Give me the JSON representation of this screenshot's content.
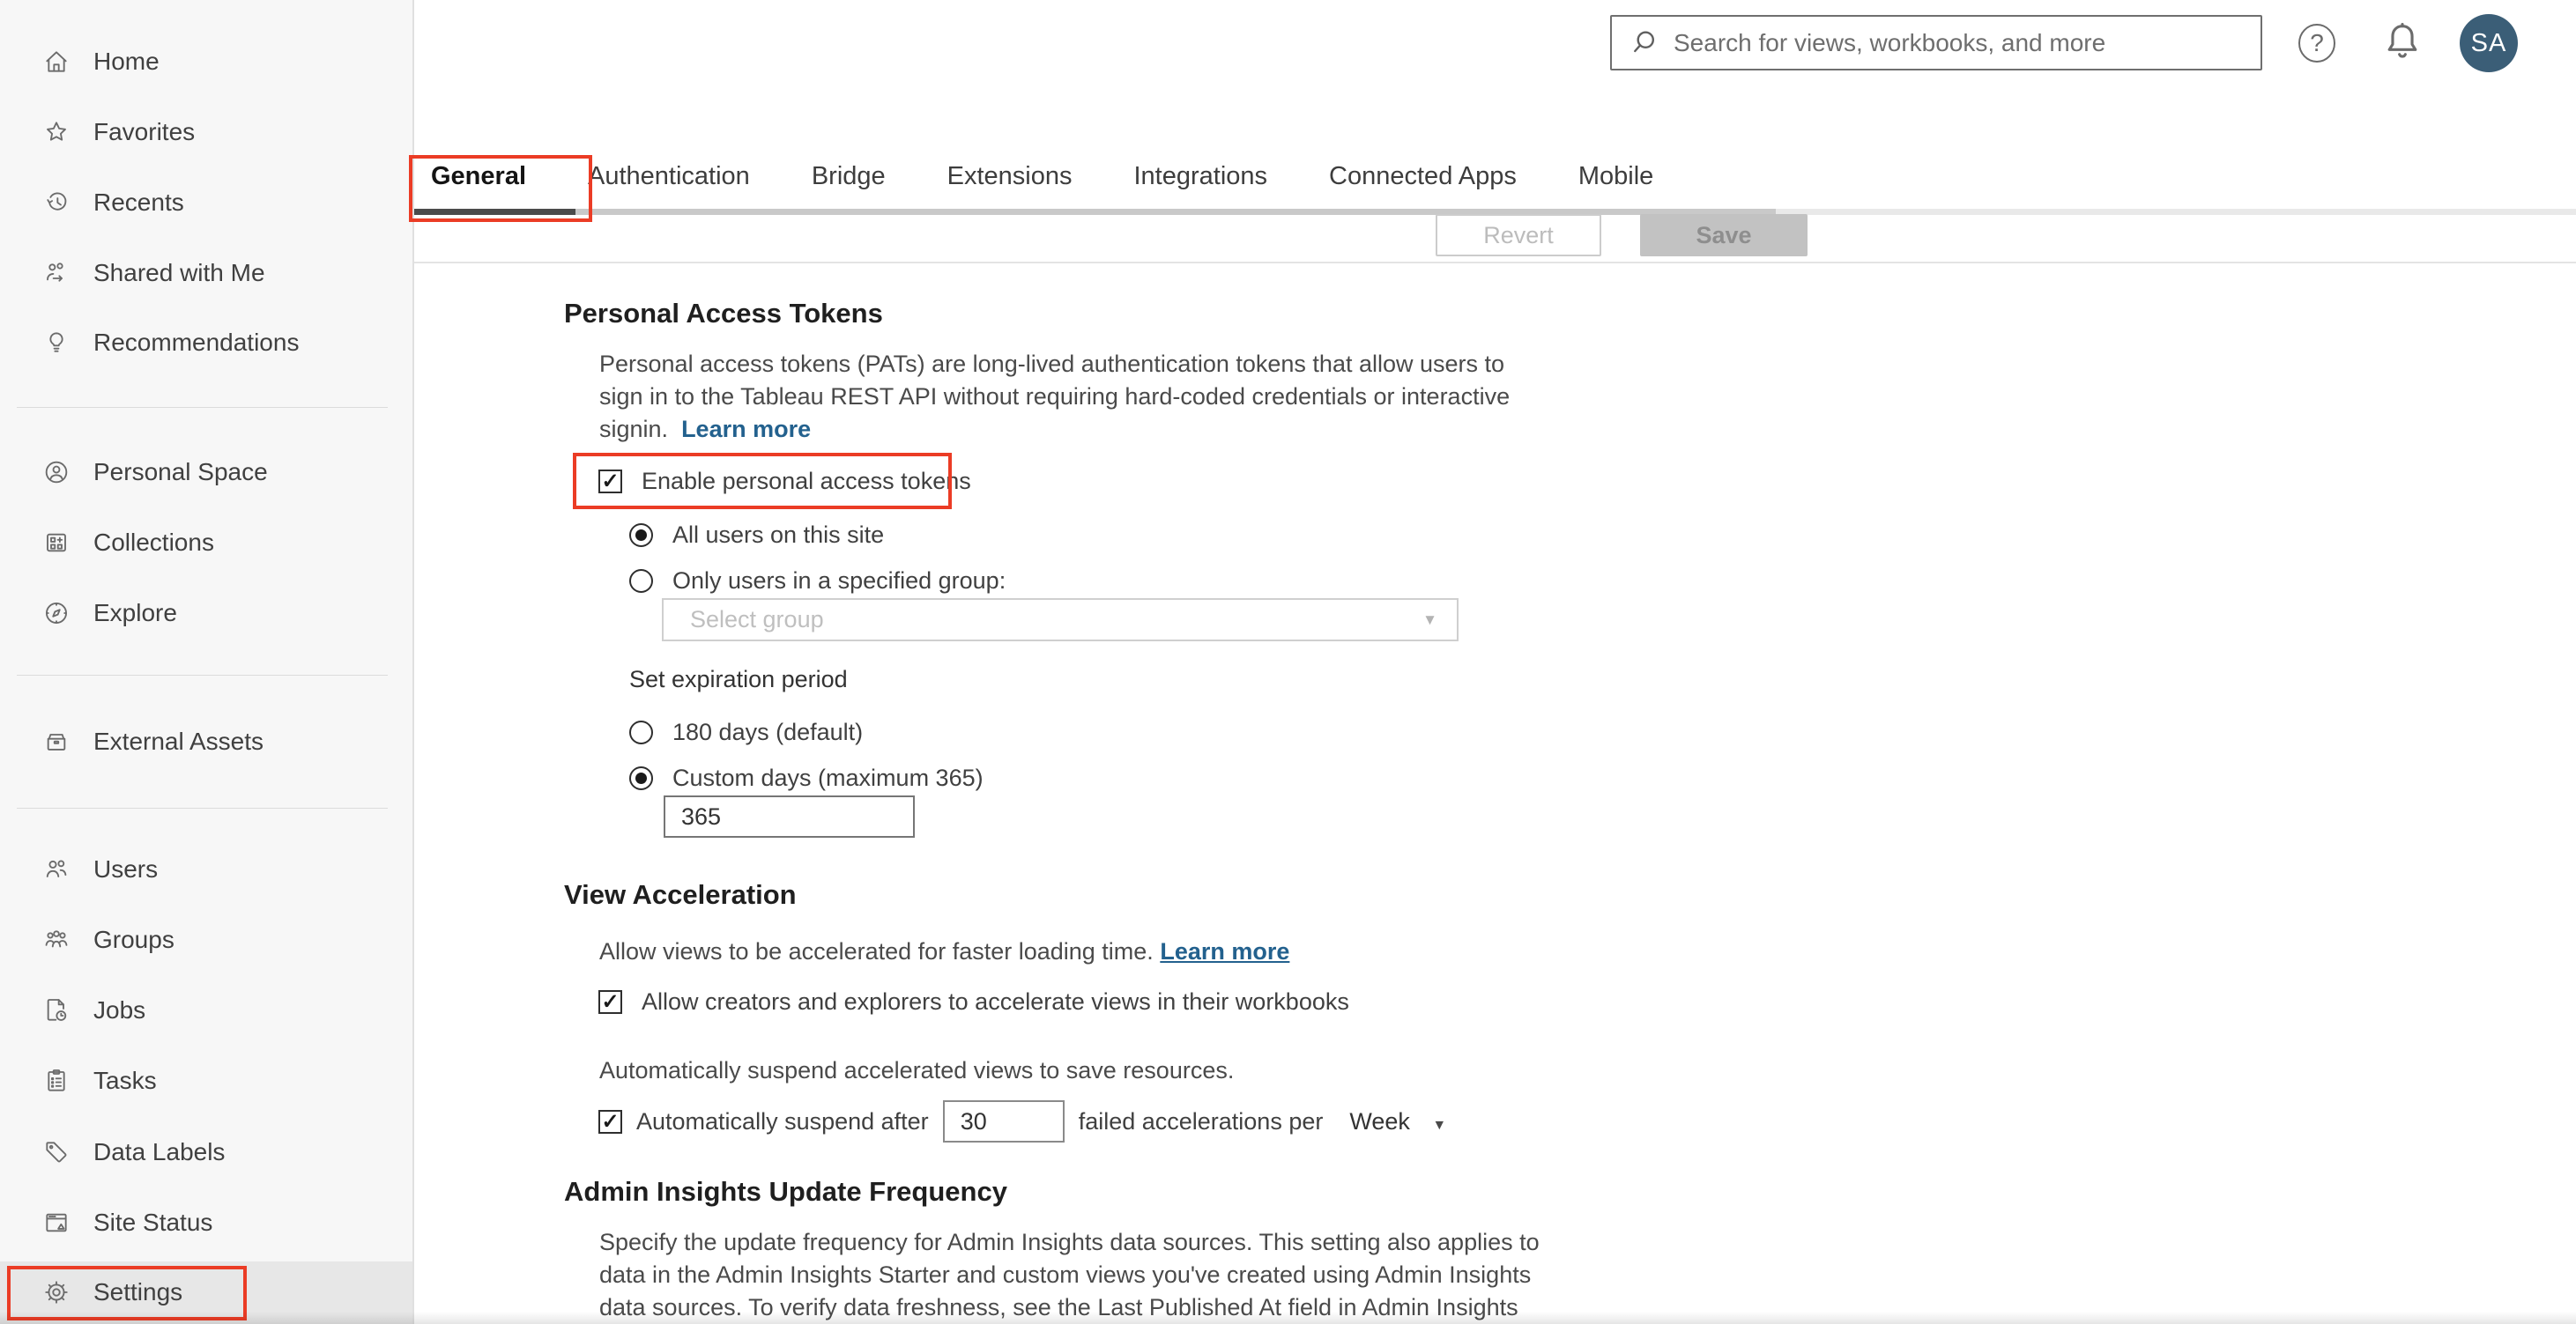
{
  "topbar": {
    "search_placeholder": "Search for views, workbooks, and more",
    "avatar_initials": "SA",
    "icons": [
      "search-icon",
      "help-icon",
      "bell-icon"
    ]
  },
  "glyphs": {
    "caret": "▼",
    "question": "?",
    "check": "✓"
  },
  "colors": {
    "annotation_red": "#eb3c25",
    "avatar_bg": "#3b5e77",
    "link_blue": "#23618e",
    "active_tab_underline": "#4b4b4b"
  },
  "sidebar": {
    "items": [
      {
        "label": "Home",
        "icon": "home-icon"
      },
      {
        "label": "Favorites",
        "icon": "star-icon"
      },
      {
        "label": "Recents",
        "icon": "history-clock-icon"
      },
      {
        "label": "Shared with Me",
        "icon": "shared-with-me-icon"
      },
      {
        "label": "Recommendations",
        "icon": "lightbulb-icon"
      },
      {
        "label": "Personal Space",
        "icon": "person-circle-icon"
      },
      {
        "label": "Collections",
        "icon": "collections-grid-icon"
      },
      {
        "label": "Explore",
        "icon": "compass-icon"
      },
      {
        "label": "External Assets",
        "icon": "asset-drawer-icon"
      },
      {
        "label": "Users",
        "icon": "users-icon"
      },
      {
        "label": "Groups",
        "icon": "groups-icon"
      },
      {
        "label": "Jobs",
        "icon": "jobs-document-clock-icon"
      },
      {
        "label": "Tasks",
        "icon": "tasks-clipboard-icon"
      },
      {
        "label": "Data Labels",
        "icon": "tag-icon"
      },
      {
        "label": "Site Status",
        "icon": "site-status-icon"
      },
      {
        "label": "Settings",
        "icon": "gear-icon"
      }
    ],
    "selected": "Settings"
  },
  "tabs": {
    "items": [
      "General",
      "Authentication",
      "Bridge",
      "Extensions",
      "Integrations",
      "Connected Apps",
      "Mobile"
    ],
    "active": "General"
  },
  "actions": {
    "revert": "Revert",
    "save": "Save"
  },
  "sections": {
    "pat": {
      "title": "Personal Access Tokens",
      "description_line1": "Personal access tokens (PATs) are long-lived authentication tokens that allow users to",
      "description_line2": "sign in to the Tableau REST API without requiring hard-coded credentials or interactive",
      "description_line3": "signin.",
      "learn_more": "Learn more",
      "enable_label": "Enable personal access tokens",
      "enable_checked": true,
      "radio_all_users": "All users on this site",
      "radio_all_users_selected": true,
      "radio_specified_group": "Only users in a specified group:",
      "radio_specified_group_selected": false,
      "select_group_placeholder": "Select group",
      "expiration_label": "Set expiration period",
      "radio_180_days": "180 days (default)",
      "radio_180_days_selected": false,
      "radio_custom_days": "Custom days (maximum 365)",
      "radio_custom_days_selected": true,
      "custom_days_value": "365"
    },
    "view_acceleration": {
      "title": "View Acceleration",
      "description": "Allow views to be accelerated for faster loading time.",
      "learn_more": "Learn more",
      "allow_label": "Allow creators and explorers to accelerate views in their workbooks",
      "allow_checked": true,
      "suspend_description": "Automatically suspend accelerated views to save resources.",
      "suspend_prefix": "Automatically suspend after",
      "suspend_value": "30",
      "suspend_suffix": "failed accelerations per",
      "suspend_period": "Week",
      "suspend_checked": true
    },
    "admin_insights": {
      "title": "Admin Insights Update Frequency",
      "description_line1": "Specify the update frequency for Admin Insights data sources. This setting also applies to",
      "description_line2": "data in the Admin Insights Starter and custom views you've created using Admin Insights",
      "description_line3": "data sources. To verify data freshness, see the Last Published At field in Admin Insights"
    }
  }
}
